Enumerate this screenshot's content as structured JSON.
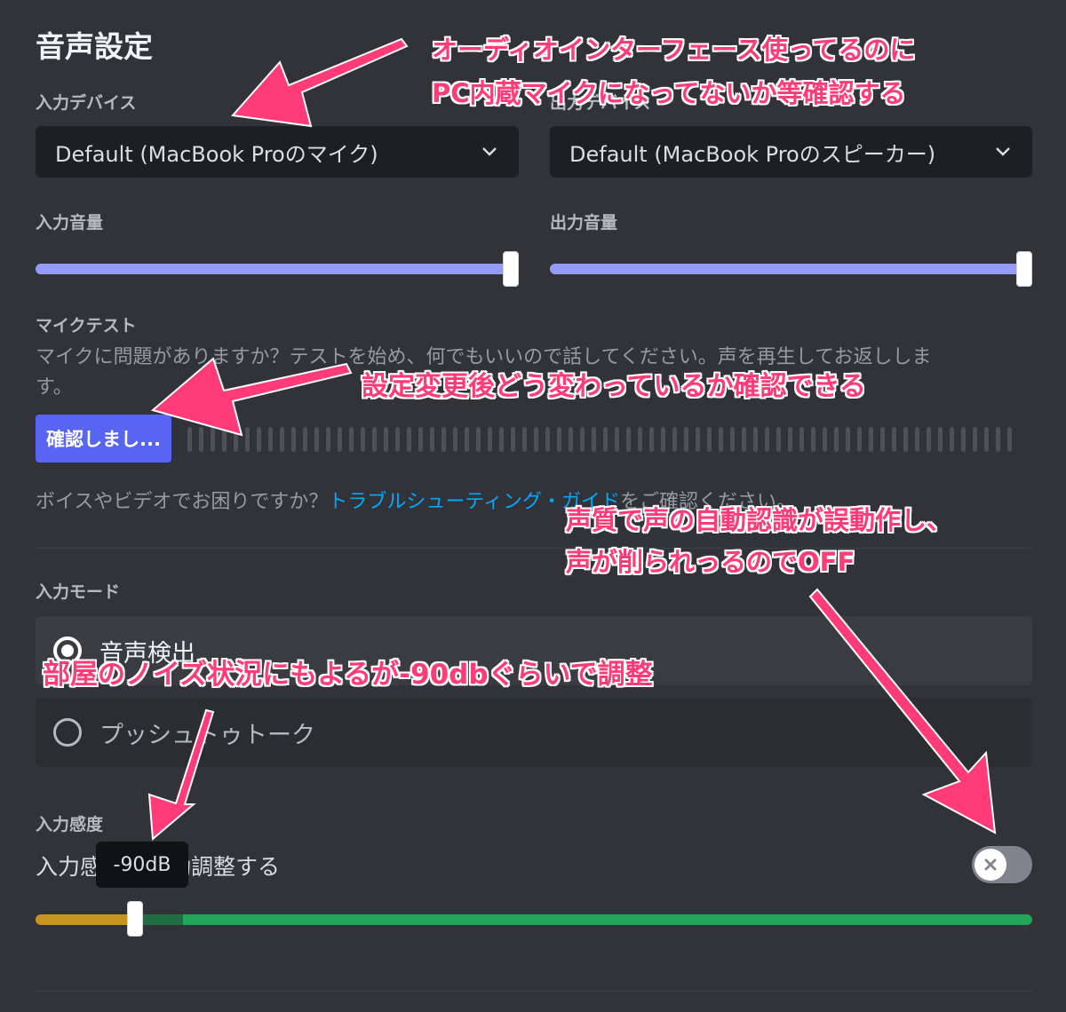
{
  "page": {
    "title": "音声設定"
  },
  "input_device": {
    "label": "入力デバイス",
    "value": "Default (MacBook Proのマイク)"
  },
  "output_device": {
    "label": "出力デバイス",
    "value": "Default (MacBook Proのスピーカー)"
  },
  "input_volume": {
    "label": "入力音量",
    "level_percent": 100
  },
  "output_volume": {
    "label": "出力音量",
    "level_percent": 100
  },
  "mic_test": {
    "label": "マイクテスト",
    "description_line1": "マイクに問題がありますか？テストを始め、何でもいいので話してください。声を再生してお返ししま",
    "description_line2": "す。",
    "button_label": "確認しまし..."
  },
  "help": {
    "prefix": "ボイスやビデオでお困りですか？",
    "link": "トラブルシューティング・ガイド",
    "suffix": "をご確認ください。"
  },
  "input_mode": {
    "label": "入力モード",
    "options": [
      {
        "label": "音声検出",
        "selected": true
      },
      {
        "label": "プッシュトゥトーク",
        "selected": false
      }
    ]
  },
  "input_sensitivity": {
    "label": "入力感度",
    "auto_label": "入力感度を自動調整する",
    "auto_enabled": false,
    "threshold_db": -90,
    "tooltip": "-90dB"
  },
  "annotations": {
    "a1_line1": "オーディオインターフェース使ってるのに",
    "a1_line2": "PC内蔵マイクになってないか等確認する",
    "a2": "設定変更後どう変わっているか確認できる",
    "a3_line1": "声質で声の自動認識が誤動作し、",
    "a3_line2": "声が削られっるのでOFF",
    "a4": "部屋のノイズ状況にもよるが-90dbぐらいで調整"
  },
  "colors": {
    "background": "#313338",
    "accent": "#5865f2",
    "slider_fill": "#949cf7",
    "sensitivity_low": "#c7951e",
    "sensitivity_high": "#23a55a",
    "link": "#00a8fc",
    "annotation": "#ff3b78"
  }
}
